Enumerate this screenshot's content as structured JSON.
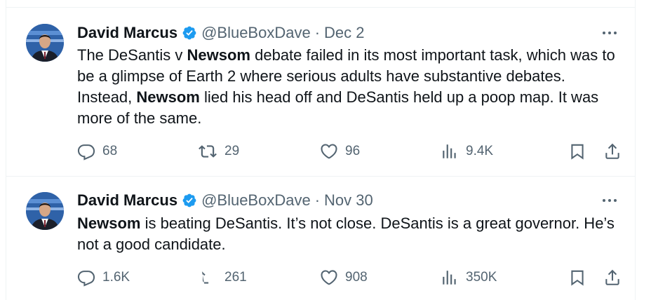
{
  "tweets": [
    {
      "name": "David Marcus",
      "handle": "@BlueBoxDave",
      "date": "Dec 2",
      "text_parts": [
        {
          "t": "The DeSantis v ",
          "bold": false
        },
        {
          "t": "Newsom",
          "bold": true
        },
        {
          "t": " debate failed in its most important task, which was to be a glimpse of Earth 2 where serious adults have substantive debates. Instead, ",
          "bold": false
        },
        {
          "t": "Newsom",
          "bold": true
        },
        {
          "t": " lied his head off and DeSantis held up a poop map. It was more of the same.",
          "bold": false
        }
      ],
      "replies": "68",
      "reposts": "29",
      "likes": "96",
      "views": "9.4K",
      "icons": {
        "reply": "reply-icon",
        "repost": "repost-icon",
        "like": "like-icon",
        "views": "views-icon",
        "bookmark": "bookmark-icon",
        "share": "share-icon",
        "more": "more-icon",
        "verified": "verified-badge-icon"
      }
    },
    {
      "name": "David Marcus",
      "handle": "@BlueBoxDave",
      "date": "Nov 30",
      "text_parts": [
        {
          "t": "Newsom",
          "bold": true
        },
        {
          "t": " is beating DeSantis. It’s not close. DeSantis is a great governor. He’s not a good candidate.",
          "bold": false
        }
      ],
      "replies": "1.6K",
      "reposts": "261",
      "likes": "908",
      "views": "350K",
      "icons": {
        "reply": "reply-icon",
        "repost": "repost-icon",
        "like": "like-icon",
        "views": "views-icon",
        "bookmark": "bookmark-icon",
        "share": "share-icon",
        "more": "more-icon",
        "verified": "verified-badge-icon"
      }
    }
  ],
  "colors": {
    "text": "#0f1419",
    "secondary": "#536471",
    "verified": "#1d9bf0",
    "border": "#eff3f4"
  }
}
